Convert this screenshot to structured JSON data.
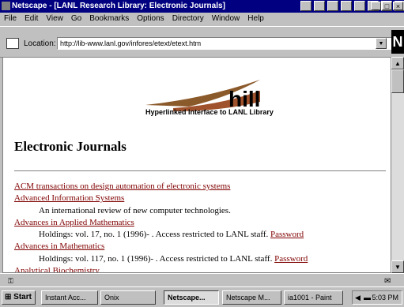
{
  "window": {
    "title": "Netscape - [LANL Research Library: Electronic Journals]"
  },
  "menu": [
    "File",
    "Edit",
    "View",
    "Go",
    "Bookmarks",
    "Options",
    "Directory",
    "Window",
    "Help"
  ],
  "location": {
    "label": "Location:",
    "url": "http://lib-www.lanl.gov/infores/etext/etext.htm"
  },
  "throbber": "N",
  "page": {
    "logo_word": "hill",
    "logo_caption": "Hyperlinked Interface to LANL Library",
    "heading": "Electronic Journals",
    "entries": [
      {
        "link": "ACM transactions on design automation of electronic systems"
      },
      {
        "link": "Advanced Information Systems",
        "desc": "An international review of new computer technologies."
      },
      {
        "link": "Advances in Applied Mathematics",
        "desc": "Holdings: vol. 17, no. 1 (1996)- . Access restricted to LANL staff.",
        "desc_link": "Password"
      },
      {
        "link": "Advances in Mathematics",
        "desc": "Holdings: vol. 117, no. 1 (1996)- . Access restricted to LANL staff.",
        "desc_link": "Password"
      },
      {
        "link": "Analytical Biochemistry"
      }
    ]
  },
  "taskbar": {
    "start": "Start",
    "tasks": [
      "Instant Acc...",
      "Onix",
      "Netscape...",
      "Netscape M...",
      "ia1001 - Paint"
    ],
    "clock": "5:03 PM"
  }
}
